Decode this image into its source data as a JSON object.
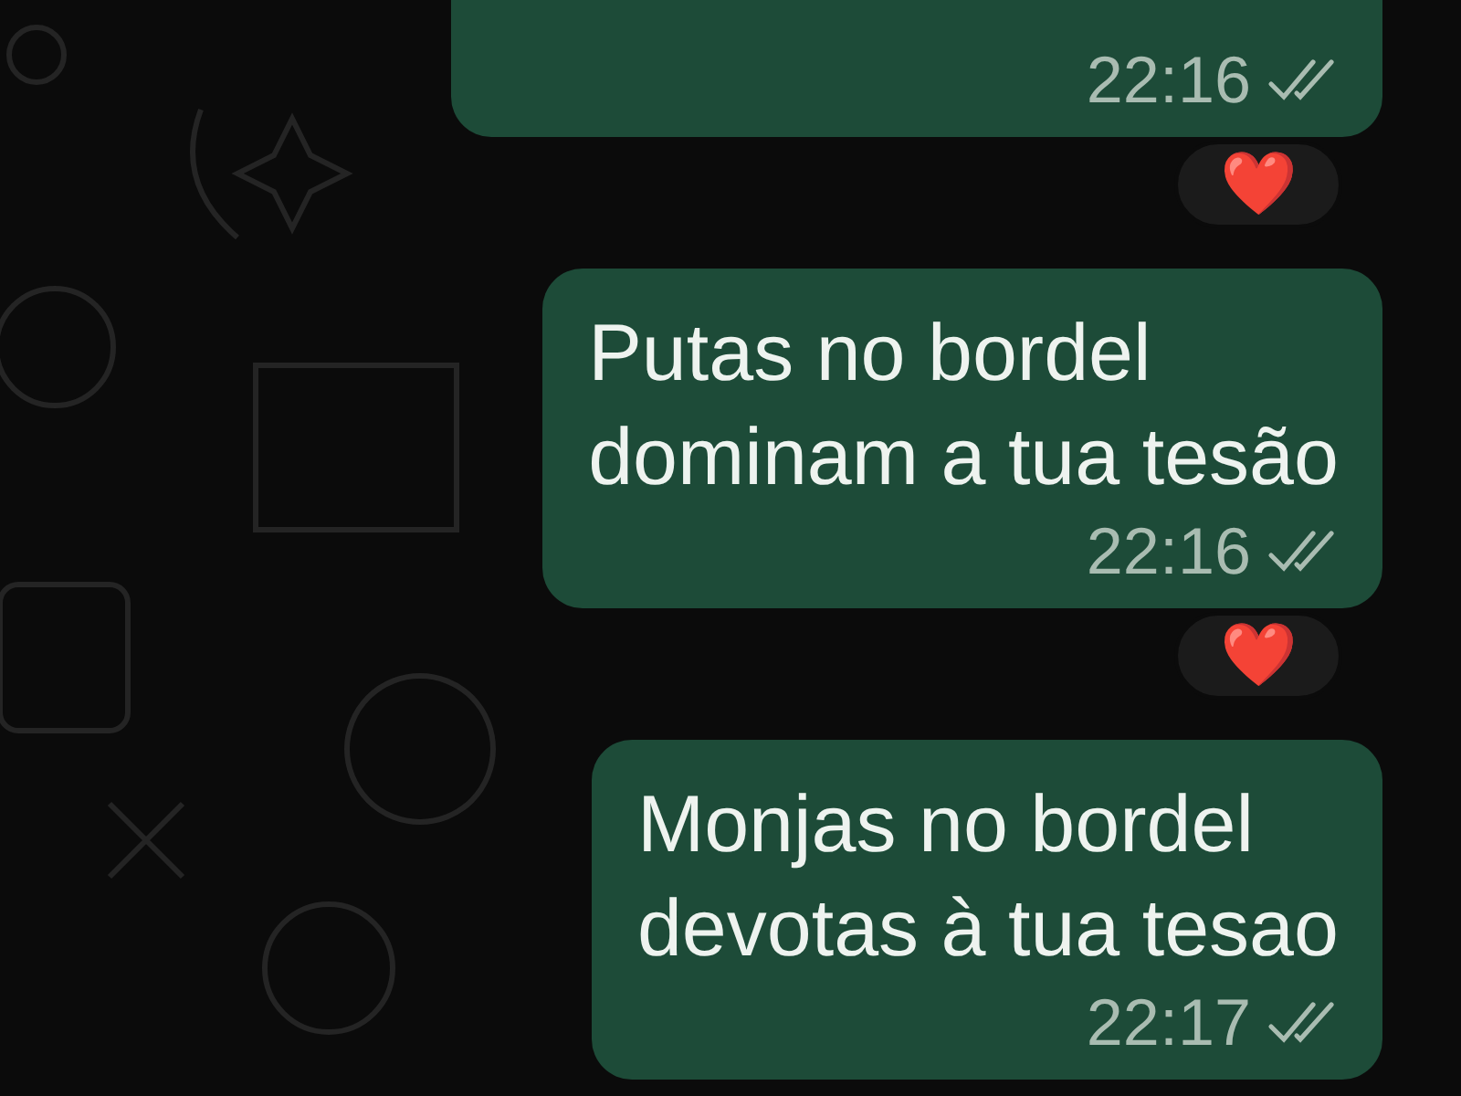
{
  "messages": [
    {
      "time": "22:16",
      "read": false,
      "reaction": "❤️"
    },
    {
      "lines": [
        "Putas no bordel",
        "dominam a tua tesão"
      ],
      "time": "22:16",
      "read": false,
      "reaction": "❤️"
    },
    {
      "lines": [
        "Monjas no bordel",
        "devotas à tua tesao"
      ],
      "time": "22:17",
      "read": false
    }
  ]
}
